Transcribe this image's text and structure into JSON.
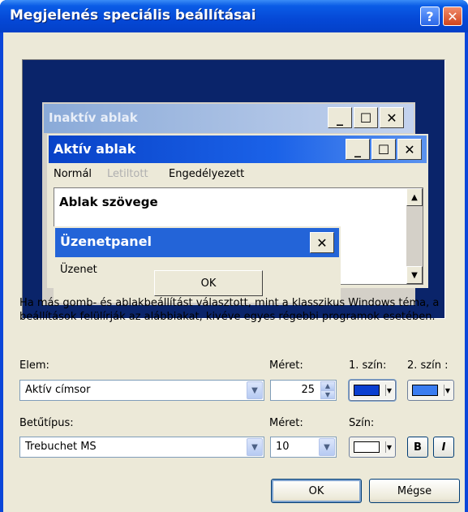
{
  "window": {
    "title": "Megjelenés speciális beállításai",
    "help_label": "?",
    "close_label": "✕"
  },
  "preview": {
    "inactive_title": "Inaktív ablak",
    "active_title": "Aktív ablak",
    "menu": [
      "Normál",
      "Letiltott",
      "Engedélyezett"
    ],
    "window_text": "Ablak szövege",
    "msgbox_title": "Üzenetpanel",
    "msgbox_text": "Üzenet",
    "msgbox_ok": "OK",
    "min_glyph": "_",
    "max_glyph": "☐",
    "close_glyph": "✕"
  },
  "info_text": "Ha más gomb- és ablakbeállítást választott, mint a klasszikus Windows téma, a beállítások felülírják az alábbiakat, kivéve egyes régebbi programok esetében.",
  "element": {
    "label": "Elem:",
    "value": "Aktív címsor",
    "size_label": "Méret:",
    "size_value": "25",
    "color1_label": "1. szín:",
    "color2_label": "2. szín :",
    "color1": "#0a3fd0",
    "color2": "#3a7cf0"
  },
  "font": {
    "label": "Betűtípus:",
    "value": "Trebuchet MS",
    "size_label": "Méret:",
    "size_value": "10",
    "color_label": "Szín:",
    "color": "#ffffff",
    "bold_label": "B",
    "italic_label": "I"
  },
  "buttons": {
    "ok": "OK",
    "cancel": "Mégse"
  }
}
